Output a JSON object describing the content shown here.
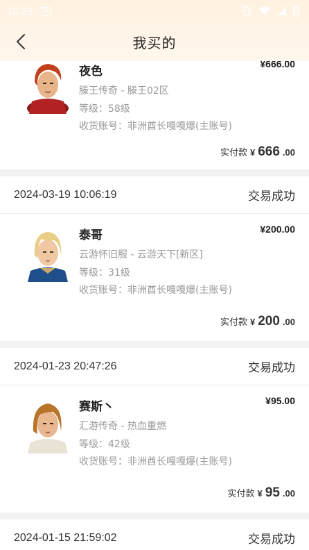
{
  "status_bar": {
    "time": "10:29",
    "a_icon": "A"
  },
  "header": {
    "title": "我买的"
  },
  "orders": [
    {
      "name": "夜色",
      "server": "滕王传奇 - 滕王02区",
      "level": "等级：58级",
      "account": "收货账号：非洲酋长嘎嘎爆(主账号)",
      "price": "¥666.00",
      "paid_label": "实付款",
      "paid_currency": "¥",
      "paid_int": "666",
      "paid_dec": ".00"
    },
    {
      "time": "2024-03-19 10:06:19",
      "status": "交易成功",
      "name": "泰哥",
      "server": "云游怀旧服 - 云游天下[新区]",
      "level": "等级：31级",
      "account": "收货账号：非洲酋长嘎嘎爆(主账号)",
      "price": "¥200.00",
      "paid_label": "实付款",
      "paid_currency": "¥",
      "paid_int": "200",
      "paid_dec": ".00"
    },
    {
      "time": "2024-01-23 20:47:26",
      "status": "交易成功",
      "name": "赛斯丶",
      "server": "汇游传奇 - 热血重燃",
      "level": "等级：42级",
      "account": "收货账号：非洲酋长嘎嘎爆(主账号)",
      "price": "¥95.00",
      "paid_label": "实付款",
      "paid_currency": "¥",
      "paid_int": "95",
      "paid_dec": ".00"
    },
    {
      "time": "2024-01-15 21:59:02",
      "status": "交易成功"
    }
  ]
}
